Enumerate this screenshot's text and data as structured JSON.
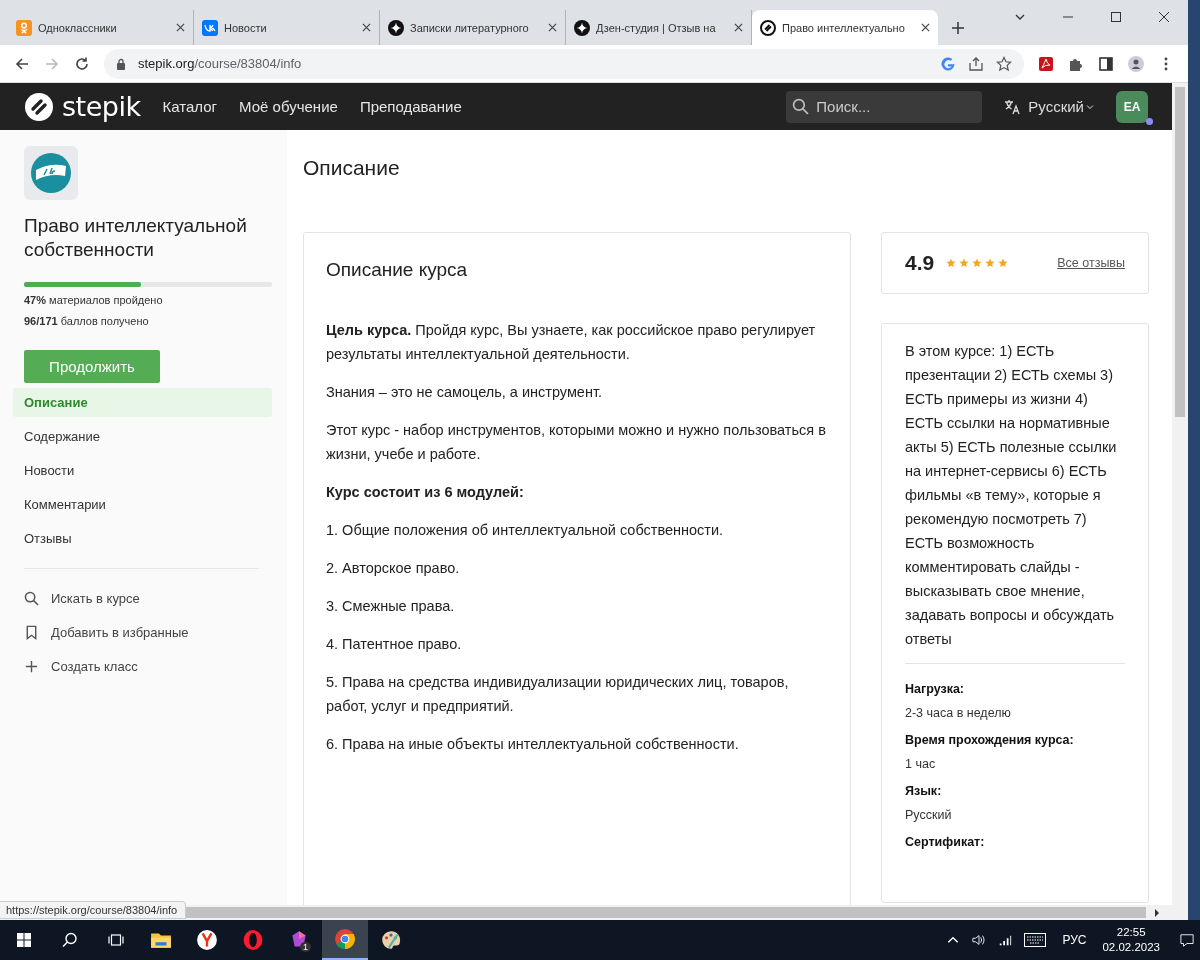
{
  "browser": {
    "tabs": [
      {
        "title": "Одноклассники",
        "kind": "ok",
        "selected": false
      },
      {
        "title": "Новости",
        "kind": "vk",
        "selected": false
      },
      {
        "title": "Записки литературного",
        "kind": "dzen",
        "selected": false
      },
      {
        "title": "Дзен-студия | Отзыв на",
        "kind": "dzen",
        "selected": false
      },
      {
        "title": "Право интеллектуально",
        "kind": "stepik",
        "selected": true
      }
    ],
    "url": {
      "host": "stepik.org",
      "path": "/course/83804/info"
    },
    "status_url": "https://stepik.org/course/83804/info"
  },
  "header": {
    "logo": "stepik",
    "nav": [
      "Каталог",
      "Моё обучение",
      "Преподавание"
    ],
    "search": {
      "placeholder": "Поиск..."
    },
    "language": "Русский",
    "avatar": "EA"
  },
  "sidebar": {
    "course_title": "Право интеллектуальной собственности",
    "progress": {
      "level": 0.47,
      "materials": "**47%** материалов пройдено",
      "points": "**96/171** баллов получено"
    },
    "continue_button": "Продолжить",
    "items": [
      {
        "label": "Описание",
        "selected": true
      },
      {
        "label": "Содержание",
        "selected": false
      },
      {
        "label": "Новости",
        "selected": false
      },
      {
        "label": "Комментарии",
        "selected": false
      },
      {
        "label": "Отзывы",
        "selected": false
      }
    ],
    "actions": [
      {
        "label": "Искать в курсе",
        "kind": "search"
      },
      {
        "label": "Добавить в избранные",
        "kind": "bookmark"
      },
      {
        "label": "Создать класс",
        "kind": "plus"
      }
    ]
  },
  "main": {
    "heading": "Описание",
    "card_title": "Описание курса",
    "paragraphs": [
      {
        "text": "**Цель курса.** Пройдя курс, Вы узнаете, как российское право регулирует результаты интеллектуальной деятельности.",
        "bold": false
      },
      {
        "text": "Знания – это не самоцель, а инструмент.",
        "bold": false
      },
      {
        "text": "Этот курс - набор инструментов, которыми можно и нужно пользоваться в жизни, учебе и работе.",
        "bold": false
      },
      {
        "text": "Курс состоит из 6 модулей:",
        "bold": true
      },
      {
        "text": "1. Общие положения об интеллектуальной собственности.",
        "bold": false
      },
      {
        "text": "2. Авторское право.",
        "bold": false
      },
      {
        "text": "3. Смежные права.",
        "bold": false
      },
      {
        "text": "4. Патентное право.",
        "bold": false
      },
      {
        "text": "5. Права на средства индивидуализации юридических лиц, товаров, работ, услуг и предприятий.",
        "bold": false
      },
      {
        "text": "6. Права на иные объекты  интеллектуальной  собственности.",
        "bold": false
      }
    ]
  },
  "rating": {
    "value": "4.9",
    "stars": 5,
    "link": "Все отзывы"
  },
  "summary": "В этом курсе: 1) ЕСТЬ презентации 2) ЕСТЬ схемы 3) ЕСТЬ примеры из жизни 4) ЕСТЬ ссылки на нормативные акты 5) ЕСТЬ полезные ссылки на интернет-сервисы 6) ЕСТЬ фильмы «в тему», которые я рекомендую посмотреть 7) ЕСТЬ возможность комментировать слайды - высказывать свое мнение, задавать вопросы и обсуждать ответы",
  "details": [
    {
      "label": "Нагрузка:",
      "value": "2-3 часа в неделю"
    },
    {
      "label": "Время прохождения курса:",
      "value": "1 час"
    },
    {
      "label": "Язык:",
      "value": "Русский"
    },
    {
      "label": "Сертификат:"
    }
  ],
  "taskbar": {
    "apps": [
      {
        "kind": "explorer",
        "selected": false
      },
      {
        "kind": "yandex",
        "selected": false
      },
      {
        "kind": "opera",
        "selected": false
      },
      {
        "kind": "gem",
        "selected": false,
        "badge": "1"
      },
      {
        "kind": "chrome",
        "selected": true
      },
      {
        "kind": "paint",
        "selected": false
      }
    ],
    "language": "РУС",
    "time": "22:55",
    "date": "02.02.2023"
  }
}
